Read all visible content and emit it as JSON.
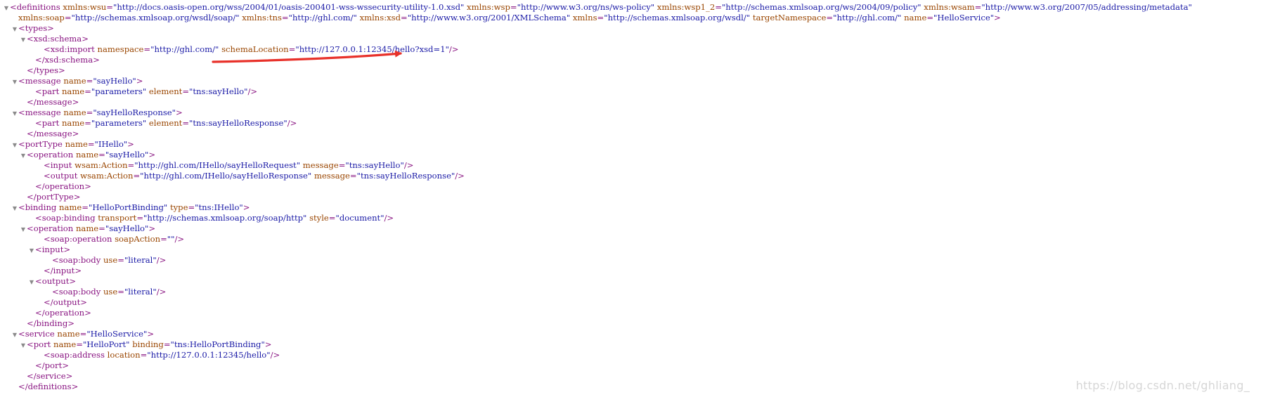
{
  "xml_lines": [
    {
      "indent": 0,
      "toggle": true,
      "tokens": [
        [
          "t",
          "<definitions"
        ],
        [
          "s",
          " "
        ],
        [
          "a",
          "xmlns:wsu"
        ],
        [
          "t",
          "="
        ],
        [
          "v",
          "\"http://docs.oasis-open.org/wss/2004/01/oasis-200401-wss-wssecurity-utility-1.0.xsd\""
        ],
        [
          "s",
          " "
        ],
        [
          "a",
          "xmlns:wsp"
        ],
        [
          "t",
          "="
        ],
        [
          "v",
          "\"http://www.w3.org/ns/ws-policy\""
        ],
        [
          "s",
          " "
        ],
        [
          "a",
          "xmlns:wsp1_2"
        ],
        [
          "t",
          "="
        ],
        [
          "v",
          "\"http://schemas.xmlsoap.org/ws/2004/09/policy\""
        ],
        [
          "s",
          " "
        ],
        [
          "a",
          "xmlns:wsam"
        ],
        [
          "t",
          "="
        ],
        [
          "v",
          "\"http://www.w3.org/2007/05/addressing/metadata\""
        ]
      ]
    },
    {
      "indent": 1,
      "toggle": false,
      "tokens": [
        [
          "a",
          "xmlns:soap"
        ],
        [
          "t",
          "="
        ],
        [
          "v",
          "\"http://schemas.xmlsoap.org/wsdl/soap/\""
        ],
        [
          "s",
          " "
        ],
        [
          "a",
          "xmlns:tns"
        ],
        [
          "t",
          "="
        ],
        [
          "v",
          "\"http://ghl.com/\""
        ],
        [
          "s",
          " "
        ],
        [
          "a",
          "xmlns:xsd"
        ],
        [
          "t",
          "="
        ],
        [
          "v",
          "\"http://www.w3.org/2001/XMLSchema\""
        ],
        [
          "s",
          " "
        ],
        [
          "a",
          "xmlns"
        ],
        [
          "t",
          "="
        ],
        [
          "v",
          "\"http://schemas.xmlsoap.org/wsdl/\""
        ],
        [
          "s",
          " "
        ],
        [
          "a",
          "targetNamespace"
        ],
        [
          "t",
          "="
        ],
        [
          "v",
          "\"http://ghl.com/\""
        ],
        [
          "s",
          " "
        ],
        [
          "a",
          "name"
        ],
        [
          "t",
          "="
        ],
        [
          "v",
          "\"HelloService\""
        ],
        [
          "t",
          ">"
        ]
      ]
    },
    {
      "indent": 1,
      "toggle": true,
      "tokens": [
        [
          "t",
          "<types>"
        ]
      ]
    },
    {
      "indent": 2,
      "toggle": true,
      "tokens": [
        [
          "t",
          "<xsd:schema>"
        ]
      ]
    },
    {
      "indent": 4,
      "toggle": false,
      "tokens": [
        [
          "t",
          "<xsd:import"
        ],
        [
          "s",
          " "
        ],
        [
          "a",
          "namespace"
        ],
        [
          "t",
          "="
        ],
        [
          "v",
          "\"http://ghl.com/\""
        ],
        [
          "s",
          " "
        ],
        [
          "a",
          "schemaLocation"
        ],
        [
          "t",
          "="
        ],
        [
          "v",
          "\"http://127.0.0.1:12345/hello?xsd=1\""
        ],
        [
          "t",
          "/>"
        ]
      ]
    },
    {
      "indent": 3,
      "toggle": false,
      "tokens": [
        [
          "t",
          "</xsd:schema>"
        ]
      ]
    },
    {
      "indent": 2,
      "toggle": false,
      "tokens": [
        [
          "t",
          "</types>"
        ]
      ]
    },
    {
      "indent": 1,
      "toggle": true,
      "tokens": [
        [
          "t",
          "<message"
        ],
        [
          "s",
          " "
        ],
        [
          "a",
          "name"
        ],
        [
          "t",
          "="
        ],
        [
          "v",
          "\"sayHello\""
        ],
        [
          "t",
          ">"
        ]
      ]
    },
    {
      "indent": 3,
      "toggle": false,
      "tokens": [
        [
          "t",
          "<part"
        ],
        [
          "s",
          " "
        ],
        [
          "a",
          "name"
        ],
        [
          "t",
          "="
        ],
        [
          "v",
          "\"parameters\""
        ],
        [
          "s",
          " "
        ],
        [
          "a",
          "element"
        ],
        [
          "t",
          "="
        ],
        [
          "v",
          "\"tns:sayHello\""
        ],
        [
          "t",
          "/>"
        ]
      ]
    },
    {
      "indent": 2,
      "toggle": false,
      "tokens": [
        [
          "t",
          "</message>"
        ]
      ]
    },
    {
      "indent": 1,
      "toggle": true,
      "tokens": [
        [
          "t",
          "<message"
        ],
        [
          "s",
          " "
        ],
        [
          "a",
          "name"
        ],
        [
          "t",
          "="
        ],
        [
          "v",
          "\"sayHelloResponse\""
        ],
        [
          "t",
          ">"
        ]
      ]
    },
    {
      "indent": 3,
      "toggle": false,
      "tokens": [
        [
          "t",
          "<part"
        ],
        [
          "s",
          " "
        ],
        [
          "a",
          "name"
        ],
        [
          "t",
          "="
        ],
        [
          "v",
          "\"parameters\""
        ],
        [
          "s",
          " "
        ],
        [
          "a",
          "element"
        ],
        [
          "t",
          "="
        ],
        [
          "v",
          "\"tns:sayHelloResponse\""
        ],
        [
          "t",
          "/>"
        ]
      ]
    },
    {
      "indent": 2,
      "toggle": false,
      "tokens": [
        [
          "t",
          "</message>"
        ]
      ]
    },
    {
      "indent": 1,
      "toggle": true,
      "tokens": [
        [
          "t",
          "<portType"
        ],
        [
          "s",
          " "
        ],
        [
          "a",
          "name"
        ],
        [
          "t",
          "="
        ],
        [
          "v",
          "\"IHello\""
        ],
        [
          "t",
          ">"
        ]
      ]
    },
    {
      "indent": 2,
      "toggle": true,
      "tokens": [
        [
          "t",
          "<operation"
        ],
        [
          "s",
          " "
        ],
        [
          "a",
          "name"
        ],
        [
          "t",
          "="
        ],
        [
          "v",
          "\"sayHello\""
        ],
        [
          "t",
          ">"
        ]
      ]
    },
    {
      "indent": 4,
      "toggle": false,
      "tokens": [
        [
          "t",
          "<input"
        ],
        [
          "s",
          " "
        ],
        [
          "a",
          "wsam:Action"
        ],
        [
          "t",
          "="
        ],
        [
          "v",
          "\"http://ghl.com/IHello/sayHelloRequest\""
        ],
        [
          "s",
          " "
        ],
        [
          "a",
          "message"
        ],
        [
          "t",
          "="
        ],
        [
          "v",
          "\"tns:sayHello\""
        ],
        [
          "t",
          "/>"
        ]
      ]
    },
    {
      "indent": 4,
      "toggle": false,
      "tokens": [
        [
          "t",
          "<output"
        ],
        [
          "s",
          " "
        ],
        [
          "a",
          "wsam:Action"
        ],
        [
          "t",
          "="
        ],
        [
          "v",
          "\"http://ghl.com/IHello/sayHelloResponse\""
        ],
        [
          "s",
          " "
        ],
        [
          "a",
          "message"
        ],
        [
          "t",
          "="
        ],
        [
          "v",
          "\"tns:sayHelloResponse\""
        ],
        [
          "t",
          "/>"
        ]
      ]
    },
    {
      "indent": 3,
      "toggle": false,
      "tokens": [
        [
          "t",
          "</operation>"
        ]
      ]
    },
    {
      "indent": 2,
      "toggle": false,
      "tokens": [
        [
          "t",
          "</portType>"
        ]
      ]
    },
    {
      "indent": 1,
      "toggle": true,
      "tokens": [
        [
          "t",
          "<binding"
        ],
        [
          "s",
          " "
        ],
        [
          "a",
          "name"
        ],
        [
          "t",
          "="
        ],
        [
          "v",
          "\"HelloPortBinding\""
        ],
        [
          "s",
          " "
        ],
        [
          "a",
          "type"
        ],
        [
          "t",
          "="
        ],
        [
          "v",
          "\"tns:IHello\""
        ],
        [
          "t",
          ">"
        ]
      ]
    },
    {
      "indent": 3,
      "toggle": false,
      "tokens": [
        [
          "t",
          "<soap:binding"
        ],
        [
          "s",
          " "
        ],
        [
          "a",
          "transport"
        ],
        [
          "t",
          "="
        ],
        [
          "v",
          "\"http://schemas.xmlsoap.org/soap/http\""
        ],
        [
          "s",
          " "
        ],
        [
          "a",
          "style"
        ],
        [
          "t",
          "="
        ],
        [
          "v",
          "\"document\""
        ],
        [
          "t",
          "/>"
        ]
      ]
    },
    {
      "indent": 2,
      "toggle": true,
      "tokens": [
        [
          "t",
          "<operation"
        ],
        [
          "s",
          " "
        ],
        [
          "a",
          "name"
        ],
        [
          "t",
          "="
        ],
        [
          "v",
          "\"sayHello\""
        ],
        [
          "t",
          ">"
        ]
      ]
    },
    {
      "indent": 4,
      "toggle": false,
      "tokens": [
        [
          "t",
          "<soap:operation"
        ],
        [
          "s",
          " "
        ],
        [
          "a",
          "soapAction"
        ],
        [
          "t",
          "="
        ],
        [
          "v",
          "\"\""
        ],
        [
          "t",
          "/>"
        ]
      ]
    },
    {
      "indent": 3,
      "toggle": true,
      "tokens": [
        [
          "t",
          "<input>"
        ]
      ]
    },
    {
      "indent": 5,
      "toggle": false,
      "tokens": [
        [
          "t",
          "<soap:body"
        ],
        [
          "s",
          " "
        ],
        [
          "a",
          "use"
        ],
        [
          "t",
          "="
        ],
        [
          "v",
          "\"literal\""
        ],
        [
          "t",
          "/>"
        ]
      ]
    },
    {
      "indent": 4,
      "toggle": false,
      "tokens": [
        [
          "t",
          "</input>"
        ]
      ]
    },
    {
      "indent": 3,
      "toggle": true,
      "tokens": [
        [
          "t",
          "<output>"
        ]
      ]
    },
    {
      "indent": 5,
      "toggle": false,
      "tokens": [
        [
          "t",
          "<soap:body"
        ],
        [
          "s",
          " "
        ],
        [
          "a",
          "use"
        ],
        [
          "t",
          "="
        ],
        [
          "v",
          "\"literal\""
        ],
        [
          "t",
          "/>"
        ]
      ]
    },
    {
      "indent": 4,
      "toggle": false,
      "tokens": [
        [
          "t",
          "</output>"
        ]
      ]
    },
    {
      "indent": 3,
      "toggle": false,
      "tokens": [
        [
          "t",
          "</operation>"
        ]
      ]
    },
    {
      "indent": 2,
      "toggle": false,
      "tokens": [
        [
          "t",
          "</binding>"
        ]
      ]
    },
    {
      "indent": 1,
      "toggle": true,
      "tokens": [
        [
          "t",
          "<service"
        ],
        [
          "s",
          " "
        ],
        [
          "a",
          "name"
        ],
        [
          "t",
          "="
        ],
        [
          "v",
          "\"HelloService\""
        ],
        [
          "t",
          ">"
        ]
      ]
    },
    {
      "indent": 2,
      "toggle": true,
      "tokens": [
        [
          "t",
          "<port"
        ],
        [
          "s",
          " "
        ],
        [
          "a",
          "name"
        ],
        [
          "t",
          "="
        ],
        [
          "v",
          "\"HelloPort\""
        ],
        [
          "s",
          " "
        ],
        [
          "a",
          "binding"
        ],
        [
          "t",
          "="
        ],
        [
          "v",
          "\"tns:HelloPortBinding\""
        ],
        [
          "t",
          ">"
        ]
      ]
    },
    {
      "indent": 4,
      "toggle": false,
      "tokens": [
        [
          "t",
          "<soap:address"
        ],
        [
          "s",
          " "
        ],
        [
          "a",
          "location"
        ],
        [
          "t",
          "="
        ],
        [
          "v",
          "\"http://127.0.0.1:12345/hello\""
        ],
        [
          "t",
          "/>"
        ]
      ]
    },
    {
      "indent": 3,
      "toggle": false,
      "tokens": [
        [
          "t",
          "</port>"
        ]
      ]
    },
    {
      "indent": 2,
      "toggle": false,
      "tokens": [
        [
          "t",
          "</service>"
        ]
      ]
    },
    {
      "indent": 1,
      "toggle": false,
      "tokens": [
        [
          "t",
          "</definitions>"
        ]
      ]
    }
  ],
  "toggle_glyph": "▼",
  "watermark": "https://blog.csdn.net/ghliang_",
  "colors": {
    "tag": "#881280",
    "attribute": "#994500",
    "value": "#1a1aa6",
    "arrow": "#e8312a",
    "watermark": "#d6d6d6"
  }
}
